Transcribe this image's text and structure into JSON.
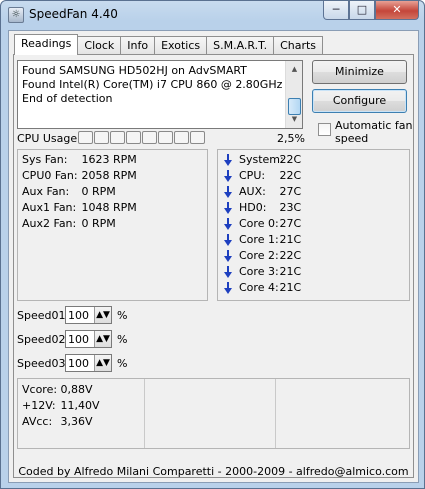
{
  "window": {
    "title": "SpeedFan 4.40",
    "icon": "speedfan-app-icon",
    "controls": {
      "minimize": "─",
      "maximize": "□",
      "close": "✕"
    }
  },
  "tabs": [
    {
      "label": "Readings",
      "active": true
    },
    {
      "label": "Clock"
    },
    {
      "label": "Info"
    },
    {
      "label": "Exotics"
    },
    {
      "label": "S.M.A.R.T."
    },
    {
      "label": "Charts"
    }
  ],
  "log": {
    "lines": [
      "Found SAMSUNG HD502HJ on AdvSMART",
      "Found Intel(R) Core(TM) i7 CPU 860 @ 2.80GHz",
      "End of detection"
    ]
  },
  "buttons": {
    "minimize": "Minimize",
    "configure": "Configure"
  },
  "auto_fan": {
    "label": "Automatic fan speed",
    "checked": false
  },
  "cpu_usage": {
    "label": "CPU Usage",
    "cores": 8,
    "percent": "2,5%"
  },
  "fans": [
    {
      "name": "Sys Fan:",
      "value": "1623 RPM"
    },
    {
      "name": "CPU0 Fan:",
      "value": "2058 RPM"
    },
    {
      "name": "Aux Fan:",
      "value": "0 RPM"
    },
    {
      "name": "Aux1 Fan:",
      "value": "1048 RPM"
    },
    {
      "name": "Aux2 Fan:",
      "value": "0 RPM"
    }
  ],
  "temps": [
    {
      "name": "System:",
      "value": "22C",
      "trend": "down"
    },
    {
      "name": "CPU:",
      "value": "22C",
      "trend": "down"
    },
    {
      "name": "AUX:",
      "value": "27C",
      "trend": "down"
    },
    {
      "name": "HD0:",
      "value": "23C",
      "trend": "down"
    },
    {
      "name": "Core 0:",
      "value": "27C",
      "trend": "down"
    },
    {
      "name": "Core 1:",
      "value": "21C",
      "trend": "down"
    },
    {
      "name": "Core 2:",
      "value": "22C",
      "trend": "down"
    },
    {
      "name": "Core 3:",
      "value": "21C",
      "trend": "down"
    },
    {
      "name": "Core 4:",
      "value": "21C",
      "trend": "down"
    }
  ],
  "speeds": [
    {
      "label": "Speed01:",
      "value": "100",
      "unit": "%"
    },
    {
      "label": "Speed02:",
      "value": "100",
      "unit": "%"
    },
    {
      "label": "Speed03:",
      "value": "100",
      "unit": "%"
    }
  ],
  "voltages": [
    {
      "name": "Vcore:",
      "value": "0,88V"
    },
    {
      "name": "+12V:",
      "value": "11,40V"
    },
    {
      "name": "AVcc:",
      "value": "3,36V"
    }
  ],
  "status_bar": "Coded by Alfredo Milani Comparetti - 2000-2009 - alfredo@almico.com"
}
